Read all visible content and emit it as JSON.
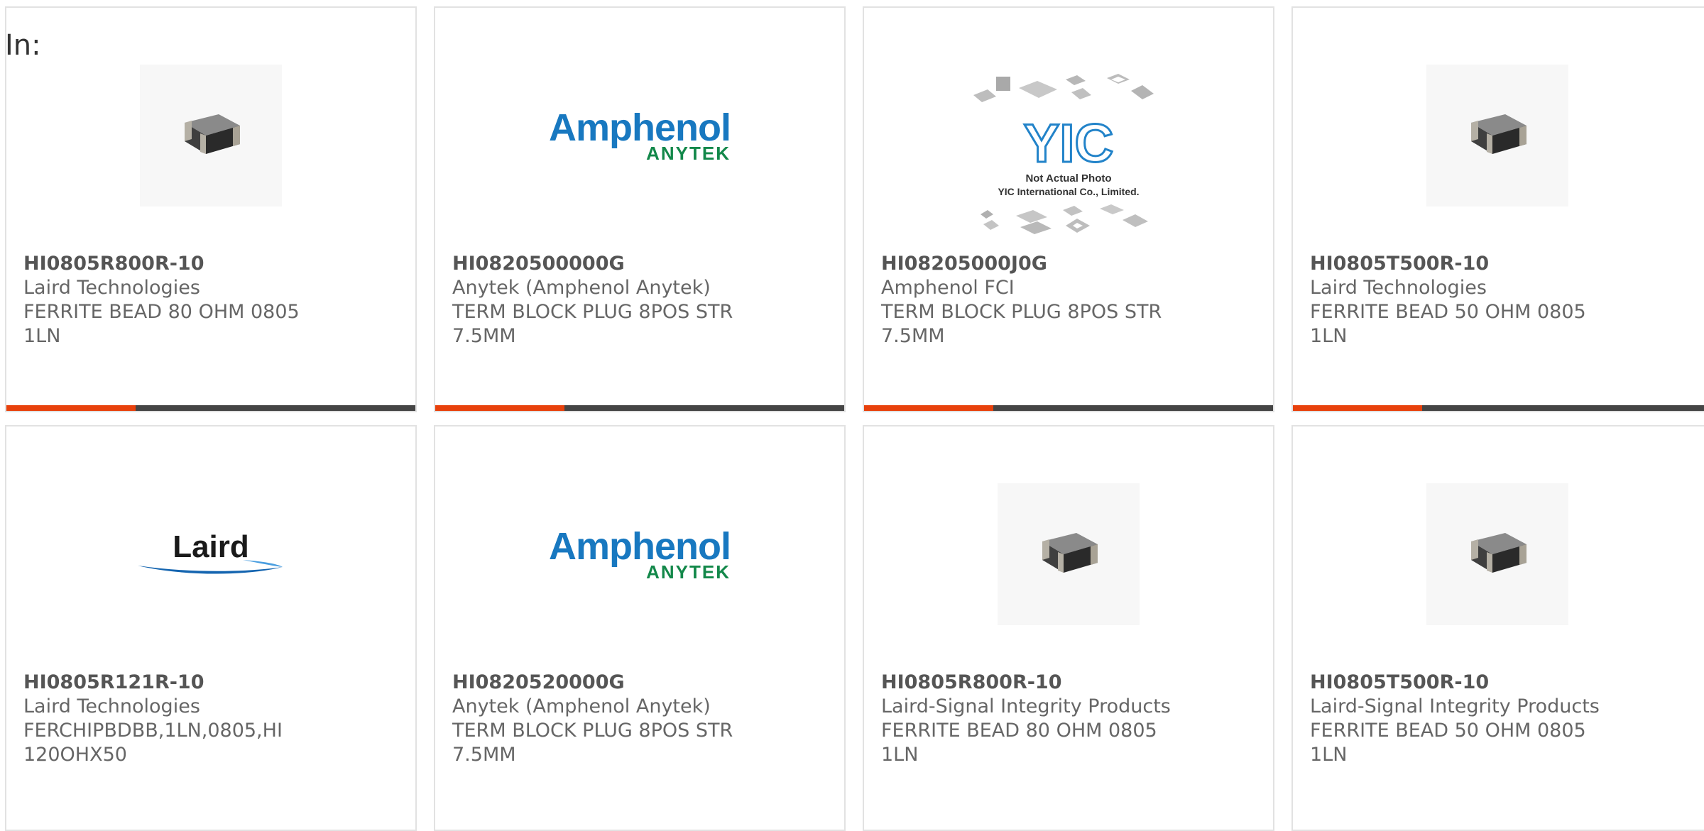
{
  "page": {
    "in_label": "In:"
  },
  "colors": {
    "accent": "#e8410c",
    "bar": "#454545",
    "border": "#e2e2e2",
    "amphenol_blue": "#1878c0",
    "anytek_green": "#13884a",
    "laird_blue": "#1565b0"
  },
  "products": [
    {
      "part_number": "HI0805R800R-10",
      "manufacturer": "Laird Technologies",
      "description": "FERRITE BEAD 80 OHM 0805 1LN",
      "image": "ferrite-bead-photo"
    },
    {
      "part_number": "HI0820500000G",
      "manufacturer": "Anytek (Amphenol Anytek)",
      "description": "TERM BLOCK PLUG 8POS STR 7.5MM",
      "image": "amphenol-anytek-logo",
      "logo_text": {
        "line1": "Amphenol",
        "line2": "ANYTEK"
      }
    },
    {
      "part_number": "HI08205000J0G",
      "manufacturer": "Amphenol FCI",
      "description": "TERM BLOCK PLUG 8POS STR 7.5MM",
      "image": "yic-not-actual-photo",
      "logo_text": {
        "line1": "YIC",
        "line2": "Not Actual Photo",
        "line3": "YIC International Co., Limited."
      }
    },
    {
      "part_number": "HI0805T500R-10",
      "manufacturer": "Laird Technologies",
      "description": "FERRITE BEAD 50 OHM 0805 1LN",
      "image": "ferrite-bead-photo"
    },
    {
      "part_number": "HI0805R121R-10",
      "manufacturer": "Laird Technologies",
      "description": "FERCHIPBDBB,1LN,0805,HI 120OHX50",
      "image": "laird-logo",
      "logo_text": {
        "line1": "Laird"
      }
    },
    {
      "part_number": "HI0820520000G",
      "manufacturer": "Anytek (Amphenol Anytek)",
      "description": "TERM BLOCK PLUG 8POS STR 7.5MM",
      "image": "amphenol-anytek-logo",
      "logo_text": {
        "line1": "Amphenol",
        "line2": "ANYTEK"
      }
    },
    {
      "part_number": "HI0805R800R-10",
      "manufacturer": "Laird-Signal Integrity Products",
      "description": "FERRITE BEAD 80 OHM 0805 1LN",
      "image": "ferrite-bead-photo"
    },
    {
      "part_number": "HI0805T500R-10",
      "manufacturer": "Laird-Signal Integrity Products",
      "description": "FERRITE BEAD 50 OHM 0805 1LN",
      "image": "ferrite-bead-photo"
    }
  ]
}
